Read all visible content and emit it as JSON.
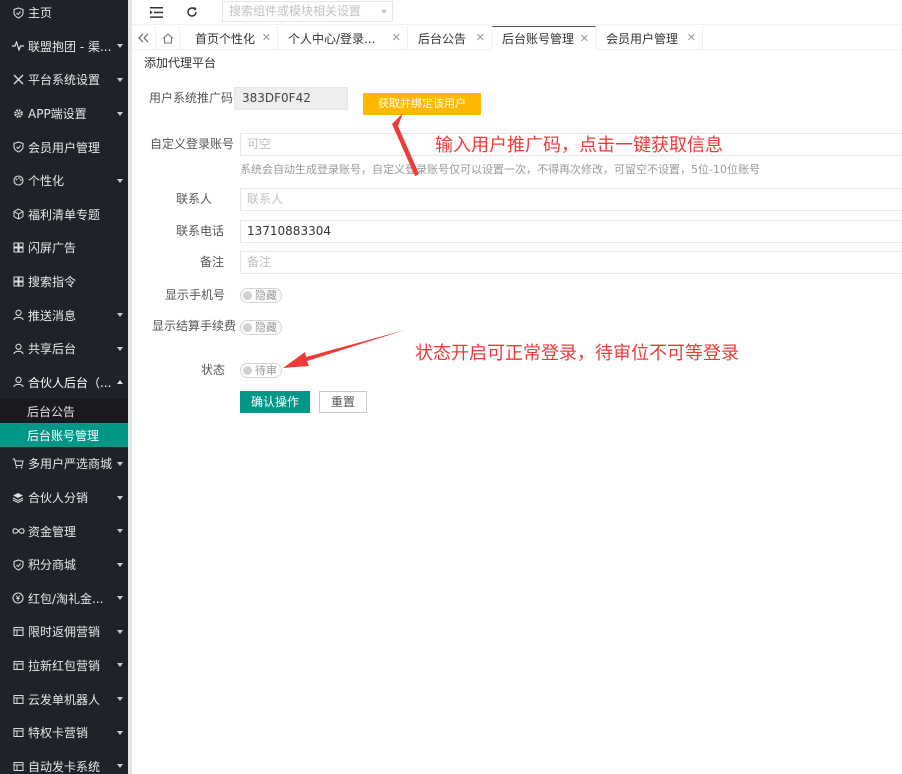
{
  "sidebar": {
    "items": [
      {
        "label": "主页",
        "icon": "shield-icon",
        "arrow": false
      },
      {
        "label": "联盟抱团 - 渠...",
        "icon": "pulse-icon",
        "arrow": true
      },
      {
        "label": "平台系统设置",
        "icon": "tools-icon",
        "arrow": true
      },
      {
        "label": "APP端设置",
        "icon": "gear-icon",
        "arrow": true
      },
      {
        "label": "会员用户管理",
        "icon": "shield-icon",
        "arrow": false
      },
      {
        "label": "个性化",
        "icon": "palette-icon",
        "arrow": true
      },
      {
        "label": "福利清单专题",
        "icon": "cube-icon",
        "arrow": false
      },
      {
        "label": "闪屏广告",
        "icon": "grid-icon",
        "arrow": false
      },
      {
        "label": "搜索指令",
        "icon": "grid-icon",
        "arrow": false
      },
      {
        "label": "推送消息",
        "icon": "user-icon",
        "arrow": true
      },
      {
        "label": "共享后台",
        "icon": "user-icon",
        "arrow": true
      },
      {
        "label": "合伙人后台（...",
        "icon": "user-icon",
        "arrow": true,
        "open": true
      }
    ],
    "submenu": [
      {
        "label": "后台公告",
        "active": false
      },
      {
        "label": "后台账号管理",
        "active": true
      }
    ],
    "items_after": [
      {
        "label": "多用户严选商城",
        "icon": "cart-icon",
        "arrow": true
      },
      {
        "label": "合伙人分销",
        "icon": "layers-icon",
        "arrow": true
      },
      {
        "label": "资金管理",
        "icon": "infinity-icon",
        "arrow": true
      },
      {
        "label": "积分商城",
        "icon": "shield-icon",
        "arrow": true
      },
      {
        "label": "红包/淘礼金...",
        "icon": "yen-icon",
        "arrow": true
      },
      {
        "label": "限时返佣营销",
        "icon": "window-icon",
        "arrow": true
      },
      {
        "label": "拉新红包营销",
        "icon": "window-icon",
        "arrow": true
      },
      {
        "label": "云发单机器人",
        "icon": "window-icon",
        "arrow": true
      },
      {
        "label": "特权卡营销",
        "icon": "window-icon",
        "arrow": true
      },
      {
        "label": "自动发卡系统",
        "icon": "window-icon",
        "arrow": true
      }
    ]
  },
  "header": {
    "search_placeholder": "搜索组件或模块相关设置"
  },
  "tabs": [
    {
      "label": "首页个性化",
      "closable": true
    },
    {
      "label": "个人中心/登录...",
      "closable": true
    },
    {
      "label": "后台公告",
      "closable": true
    },
    {
      "label": "后台账号管理",
      "closable": true,
      "active": true
    },
    {
      "label": "会员用户管理",
      "closable": true
    }
  ],
  "page": {
    "title": "添加代理平台"
  },
  "form": {
    "code_label": "用户系统推广码",
    "code_value": "383DF0F42",
    "fetch_button": "获取并绑定该用户",
    "login_label": "自定义登录账号",
    "login_placeholder": "可空",
    "login_help": "系统会自动生成登录账号，自定义登录账号仅可以设置一次，不得再次修改，可留空不设置，5位-10位账号",
    "contact_label": "联系人",
    "contact_placeholder": "联系人",
    "phone_label": "联系电话",
    "phone_value": "13710883304",
    "remark_label": "备注",
    "remark_placeholder": "备注",
    "show_phone_label": "显示手机号",
    "show_phone_state": "隐藏",
    "show_fee_label": "显示结算手续费",
    "show_fee_state": "隐藏",
    "status_label": "状态",
    "status_state": "待审",
    "confirm_button": "确认操作",
    "reset_button": "重置"
  },
  "annotations": {
    "top": "输入用户推广码，点击一键获取信息",
    "bottom": "状态开启可正常登录，待审位不可等登录",
    "color": "#f03a3a"
  }
}
